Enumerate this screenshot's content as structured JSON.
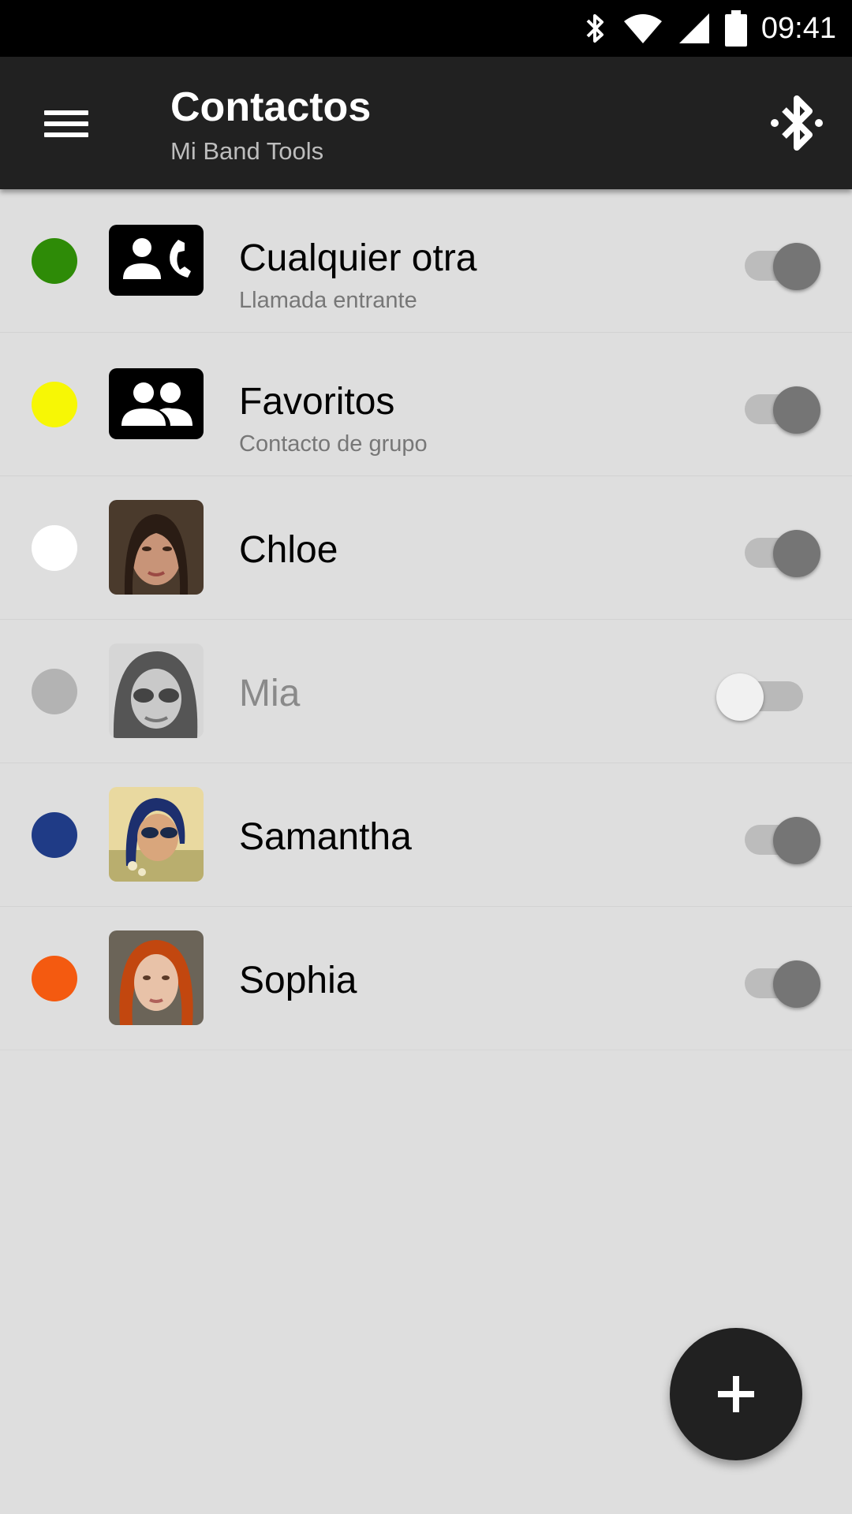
{
  "status_bar": {
    "time": "09:41",
    "icons": [
      "bluetooth-icon",
      "wifi-icon",
      "signal-icon",
      "battery-icon"
    ]
  },
  "app_bar": {
    "title": "Contactos",
    "subtitle": "Mi Band Tools",
    "left_icon": "menu-icon",
    "right_icon": "bluetooth-search-icon"
  },
  "contacts": [
    {
      "name": "Cualquier otra",
      "subtitle": "Llamada entrante",
      "color": "#2e8b07",
      "avatar": "incoming-call-icon",
      "enabled": true
    },
    {
      "name": "Favoritos",
      "subtitle": "Contacto de grupo",
      "color": "#f7f705",
      "avatar": "group-icon",
      "enabled": true
    },
    {
      "name": "Chloe",
      "subtitle": "",
      "color": "#ffffff",
      "avatar": "photo",
      "enabled": true
    },
    {
      "name": "Mia",
      "subtitle": "",
      "color": "#b3b3b3",
      "avatar": "photo",
      "enabled": false
    },
    {
      "name": "Samantha",
      "subtitle": "",
      "color": "#1f3b86",
      "avatar": "photo",
      "enabled": true
    },
    {
      "name": "Sophia",
      "subtitle": "",
      "color": "#f45a10",
      "avatar": "photo",
      "enabled": true
    }
  ],
  "fab": {
    "icon": "plus-icon"
  }
}
